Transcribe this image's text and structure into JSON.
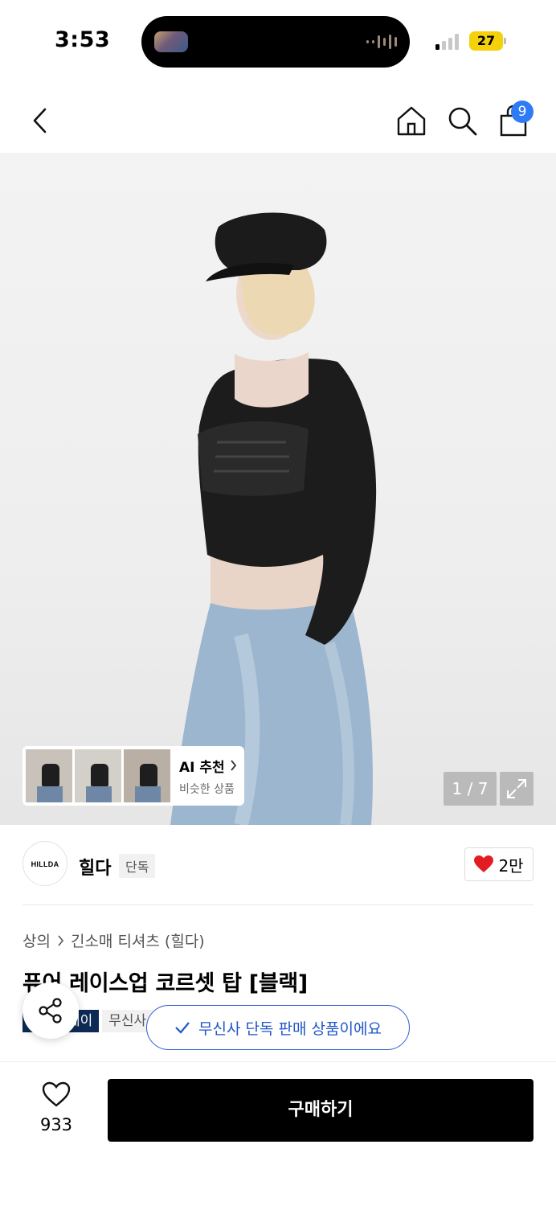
{
  "status": {
    "time": "3:53",
    "battery": "27"
  },
  "nav": {
    "cart_count": "9"
  },
  "gallery": {
    "counter": "1 / 7"
  },
  "ai_recommend": {
    "title": "AI 추천",
    "subtitle": "비슷한 상품"
  },
  "brand": {
    "logo": "HILLDA",
    "name": "힐다",
    "tag": "단독",
    "likes": "2만"
  },
  "breadcrumb": {
    "category": "상의",
    "subcategory": "긴소매 티셔츠 (힐다)"
  },
  "product": {
    "title": "퓨어 레이스업 코르셋 탑 [블랙]"
  },
  "badges": {
    "dark": "페이",
    "light": "무신사"
  },
  "toast": {
    "text": "무신사 단독 판매 상품이에요"
  },
  "bottom": {
    "wish_count": "933",
    "buy_label": "구매하기"
  },
  "colors": {
    "accent_blue": "#2f7bf5",
    "toast_blue": "#1f56c9",
    "heart_red": "#e31b23",
    "badge_navy": "#0c2a53"
  }
}
